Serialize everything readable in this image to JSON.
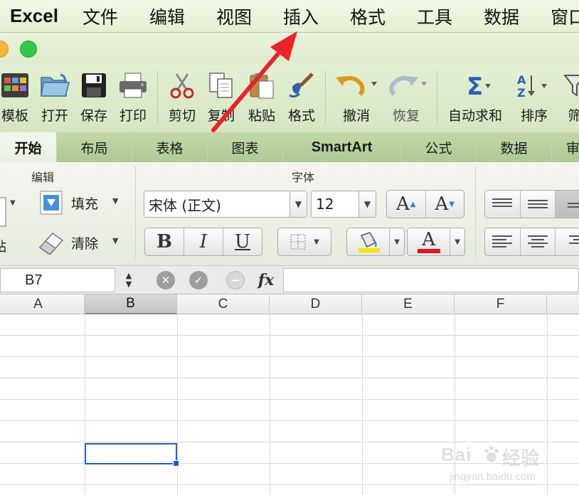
{
  "menubar": {
    "app": "Excel",
    "items": [
      "文件",
      "编辑",
      "视图",
      "插入",
      "格式",
      "工具",
      "数据",
      "窗口"
    ]
  },
  "toolbar": {
    "buttons": [
      {
        "label": "模板",
        "icon": "template-grid-icon"
      },
      {
        "label": "打开",
        "icon": "open-folder-icon"
      },
      {
        "label": "保存",
        "icon": "save-disk-icon"
      },
      {
        "label": "打印",
        "icon": "printer-icon"
      },
      {
        "label": "剪切",
        "icon": "scissors-icon"
      },
      {
        "label": "复制",
        "icon": "copy-icon"
      },
      {
        "label": "粘贴",
        "icon": "paste-clipboard-icon"
      },
      {
        "label": "格式",
        "icon": "format-painter-brush-icon"
      },
      {
        "label": "撤消",
        "icon": "undo-arrow-icon"
      },
      {
        "label": "恢复",
        "icon": "redo-arrow-icon"
      },
      {
        "label": "自动求和",
        "icon": "sigma-autosum-icon"
      },
      {
        "label": "排序",
        "icon": "sort-az-icon"
      },
      {
        "label": "筛",
        "icon": "filter-funnel-icon"
      }
    ]
  },
  "tabs": [
    "开始",
    "布局",
    "表格",
    "图表",
    "SmartArt",
    "公式",
    "数据",
    "审"
  ],
  "ribbon": {
    "groups": {
      "edit": "编辑",
      "font": "字体"
    },
    "paste_label": "贴",
    "fill_label": "填充",
    "clear_label": "清除",
    "font_name": "宋体 (正文)",
    "font_size": "12",
    "bold": "B",
    "italic": "I",
    "underline": "U",
    "grow_font": "A",
    "shrink_font": "A",
    "font_color_glyph": "A",
    "colors": {
      "highlight": "#f3e600",
      "font_color": "#e0141e"
    }
  },
  "formula_bar": {
    "name_box": "B7",
    "fx": "fx",
    "cancel_icon": "x-circle-icon",
    "confirm_icon": "check-circle-icon"
  },
  "columns": [
    "A",
    "B",
    "C",
    "D",
    "E",
    "F"
  ],
  "selected_cell": "B7",
  "annotation_arrow_color": "#e8232a",
  "watermark": {
    "line1": "Bai",
    "line2": "经验",
    "url": "jingyan.baidu.com"
  }
}
